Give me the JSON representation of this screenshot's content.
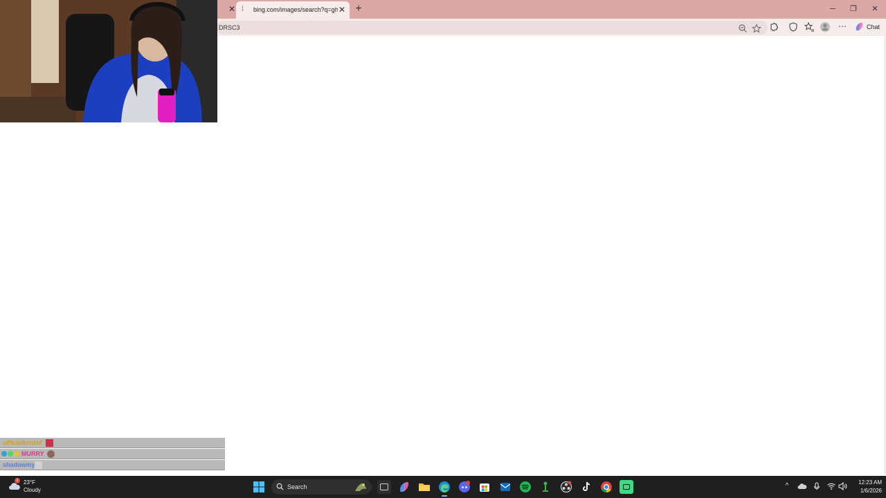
{
  "browser": {
    "tabs": [
      {
        "title": "bing.com/images/search?q=ghari",
        "active": true
      }
    ],
    "address_text": "DRSC3",
    "copilot_label": "Chat",
    "accent_color": "#dba8a6"
  },
  "chat_overlay": {
    "messages": [
      {
        "user": "officialkristof",
        "user_color": "#d4a017"
      },
      {
        "user": "MURRY",
        "user_color": "#d43c8a"
      },
      {
        "user": "shadowmy",
        "user_color": "#5a7fd6"
      }
    ]
  },
  "taskbar": {
    "weather": {
      "temp": "23°F",
      "condition": "Cloudy",
      "badge": "1"
    },
    "search_label": "Search",
    "clock": {
      "time": "12:23 AM",
      "date": "1/6/2026"
    },
    "apps": [
      "task-view",
      "copilot",
      "file-explorer",
      "edge",
      "discord",
      "store",
      "outlook",
      "spotify",
      "joystick",
      "obs",
      "tiktok",
      "chrome",
      "terminal"
    ]
  }
}
